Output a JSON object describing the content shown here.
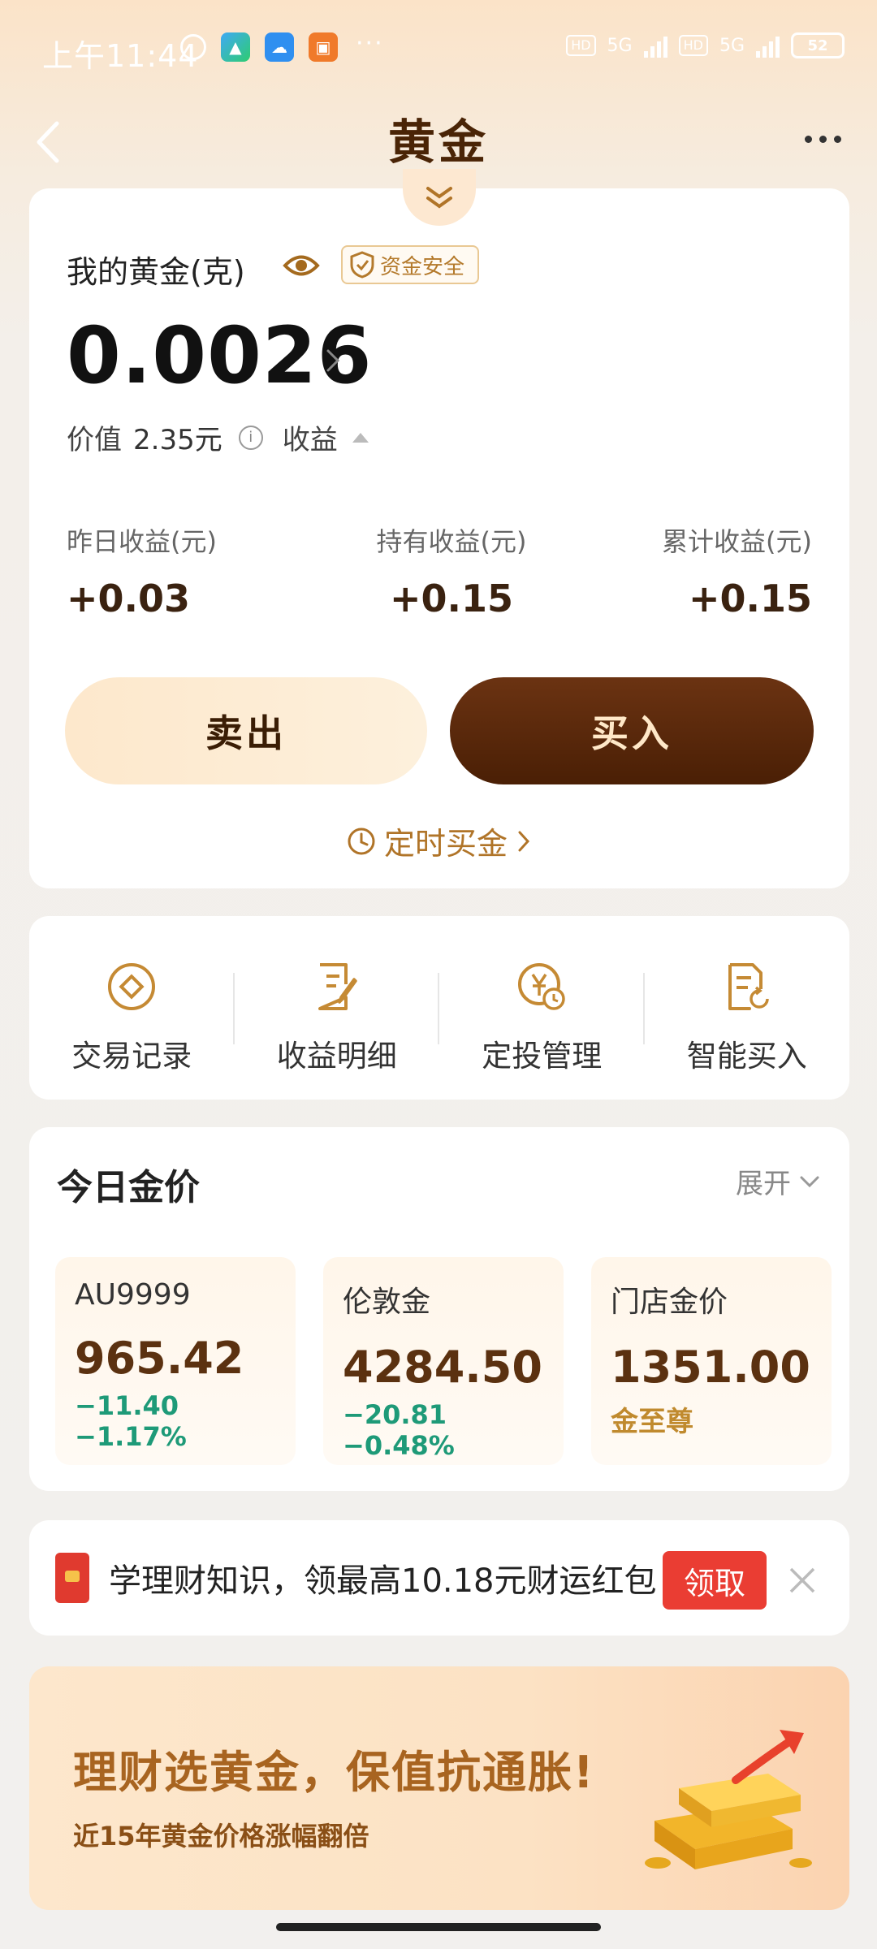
{
  "status_bar": {
    "time": "上午11:44",
    "dots": "···",
    "battery": "52",
    "network_1": "5G",
    "network_2": "5G",
    "hd_1": "HD",
    "hd_2": "HD"
  },
  "nav": {
    "title": "黄金"
  },
  "holdings": {
    "label": "我的黄金(克)",
    "safe_badge": "资金安全",
    "amount": "0.0026",
    "value_label": "价值",
    "value_amount": "2.35元",
    "profit_label": "收益",
    "stats": [
      {
        "label": "昨日收益(元)",
        "value": "+0.03"
      },
      {
        "label": "持有收益(元)",
        "value": "+0.15"
      },
      {
        "label": "累计收益(元)",
        "value": "+0.15"
      }
    ],
    "sell_label": "卖出",
    "buy_label": "买入",
    "timed_buy_label": "定时买金"
  },
  "actions": [
    {
      "label": "交易记录",
      "icon": "target-icon"
    },
    {
      "label": "收益明细",
      "icon": "document-edit-icon"
    },
    {
      "label": "定投管理",
      "icon": "yen-clock-icon"
    },
    {
      "label": "智能买入",
      "icon": "document-refresh-icon"
    }
  ],
  "today_price": {
    "title": "今日金价",
    "expand_label": "展开",
    "items": [
      {
        "name": "AU9999",
        "price": "965.42",
        "change": "−11.40  −1.17%"
      },
      {
        "name": "伦敦金",
        "price": "4284.50",
        "change": "−20.81  −0.48%"
      },
      {
        "name": "门店金价",
        "price": "1351.00",
        "sub": "金至尊"
      }
    ]
  },
  "promo": {
    "text": "学理财知识，领最高10.18元财运红包",
    "claim_label": "领取"
  },
  "banner": {
    "headline": "理财选黄金，保值抗通胀!",
    "subtext": "近15年黄金价格涨幅翻倍"
  },
  "colors": {
    "accent_brown": "#4a1f05",
    "gold_text": "#b07428",
    "down_green": "#1e9a78",
    "promo_red": "#ea3d33"
  }
}
